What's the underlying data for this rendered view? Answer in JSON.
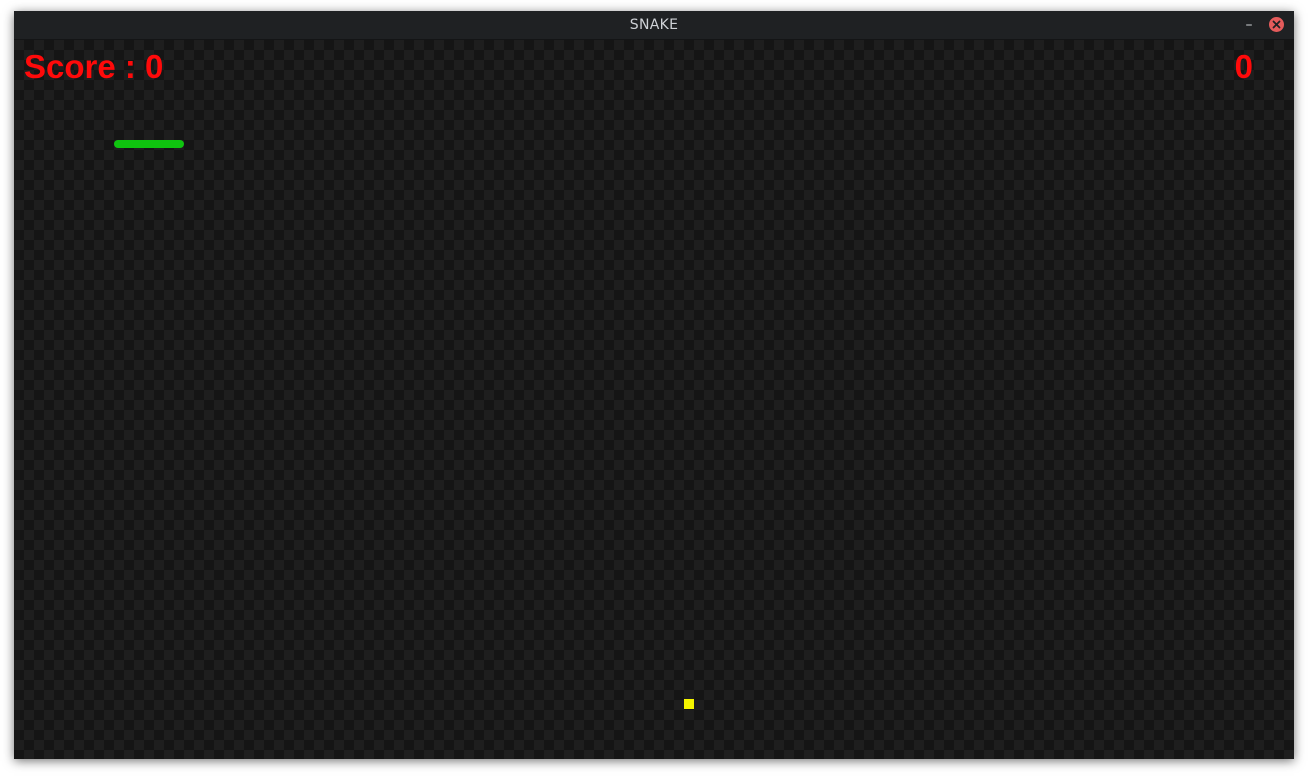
{
  "window": {
    "title": "SNAKE",
    "minimize_label": "–",
    "close_icon": "close-icon"
  },
  "hud": {
    "score_text": "Score : 0",
    "high_score_text": "0"
  },
  "game": {
    "snake_color": "#0fc40f",
    "food_color": "#f5f500",
    "text_color": "#ff0a0a"
  }
}
